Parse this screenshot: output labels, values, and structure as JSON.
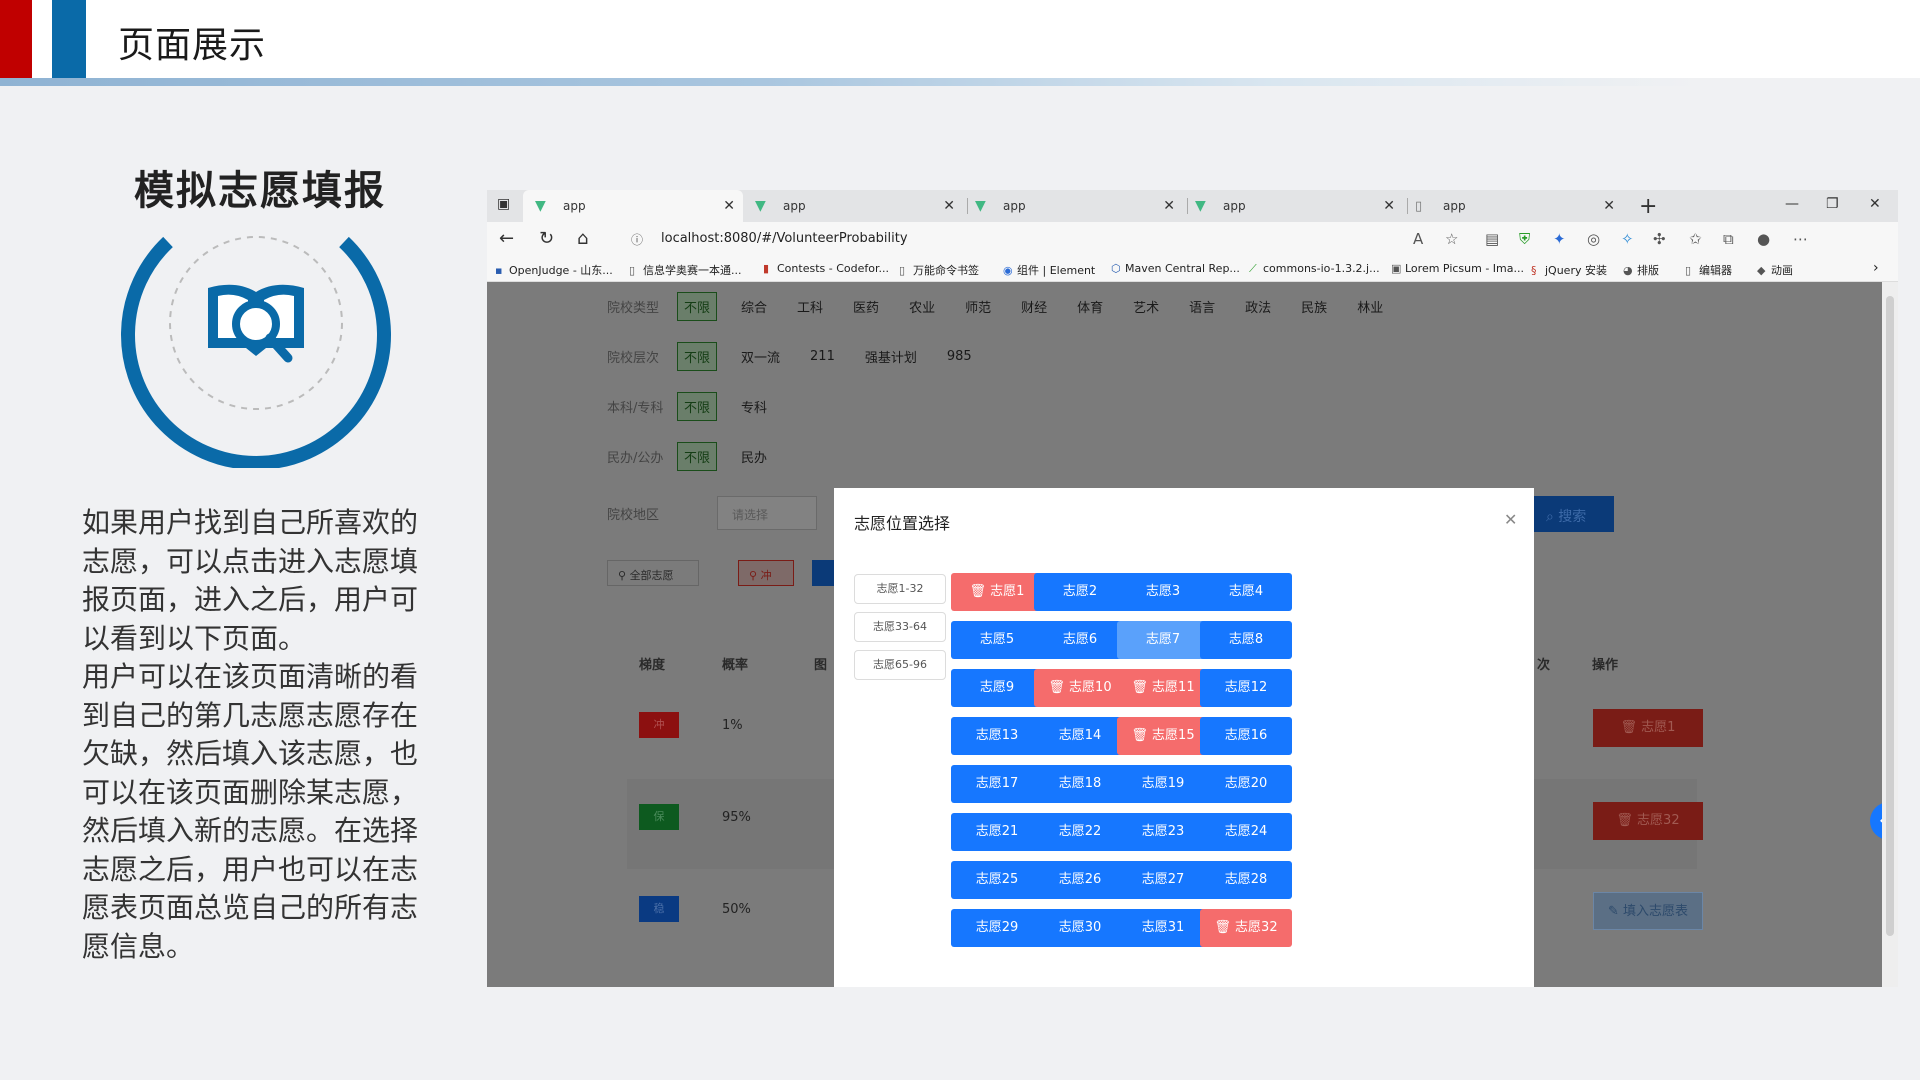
{
  "slide": {
    "title": "页面展示",
    "section_title": "模拟志愿填报",
    "description": [
      "如果用户找到自己所喜欢的志愿，可以点击进入志愿填报页面，进入之后，用户可以看到以下页面。",
      "用户可以在该页面清晰的看到自己的第几志愿志愿存在欠缺，然后填入该志愿，也可以在该页面删除某志愿，然后填入新的志愿。在选择志愿之后，用户也可以在志愿表页面总览自己的所有志愿信息。"
    ],
    "colors": {
      "red": "#c00000",
      "blue": "#0a6aa8"
    }
  },
  "browser": {
    "tabs": [
      {
        "label": "app",
        "icon": "vue-logo-icon"
      },
      {
        "label": "app",
        "icon": "vue-logo-icon"
      },
      {
        "label": "app",
        "icon": "vue-logo-icon"
      },
      {
        "label": "app",
        "icon": "vue-logo-icon"
      },
      {
        "label": "app",
        "icon": "document-icon"
      }
    ],
    "url": "localhost:8080/#/VolunteerProbability",
    "bookmarks": [
      "OpenJudge - 山东...",
      "信息学奥赛一本通...",
      "Contests - Codefor...",
      "万能命令书签",
      "组件 | Element",
      "Maven Central Rep...",
      "commons-io-1.3.2.j...",
      "Lorem Picsum - Ima...",
      "jQuery 安装",
      "排版",
      "编辑器",
      "动画"
    ]
  },
  "page": {
    "filters": [
      {
        "label": "院校类型",
        "any": "不限",
        "options": [
          "综合",
          "工科",
          "医药",
          "农业",
          "师范",
          "财经",
          "体育",
          "艺术",
          "语言",
          "政法",
          "民族",
          "林业"
        ]
      },
      {
        "label": "院校层次",
        "any": "不限",
        "options": [
          "双一流",
          "211",
          "强基计划",
          "985"
        ]
      },
      {
        "label": "本科/专科",
        "any": "不限",
        "options": [
          "专科"
        ]
      },
      {
        "label": "民办/公办",
        "any": "不限",
        "options": [
          "民办"
        ]
      }
    ],
    "region_label": "院校地区",
    "region_placeholder": "请选择",
    "search_label": "搜索",
    "all_button": "全部志愿",
    "chong_button": "冲",
    "columns": {
      "level": "梯度",
      "prob": "概率",
      "icon": "图",
      "rank": "次",
      "op": "操作"
    },
    "rows": [
      {
        "level": "冲",
        "prob": "1%",
        "op": "志愿1",
        "level_color": "#8c1010"
      },
      {
        "level": "保",
        "prob": "95%",
        "op": "志愿32",
        "level_color": "#0d5a1f"
      },
      {
        "level": "稳",
        "prob": "50%",
        "op": "填入志愿表",
        "level_color": "#0a3a82"
      }
    ]
  },
  "modal": {
    "title": "志愿位置选择",
    "ranges": [
      "志愿1-32",
      "志愿33-64",
      "志愿65-96"
    ],
    "slots": [
      {
        "label": "志愿1",
        "state": "filled"
      },
      {
        "label": "志愿2",
        "state": "empty"
      },
      {
        "label": "志愿3",
        "state": "empty"
      },
      {
        "label": "志愿4",
        "state": "empty"
      },
      {
        "label": "志愿5",
        "state": "empty"
      },
      {
        "label": "志愿6",
        "state": "empty"
      },
      {
        "label": "志愿7",
        "state": "hover"
      },
      {
        "label": "志愿8",
        "state": "empty"
      },
      {
        "label": "志愿9",
        "state": "empty"
      },
      {
        "label": "志愿10",
        "state": "filled"
      },
      {
        "label": "志愿11",
        "state": "filled"
      },
      {
        "label": "志愿12",
        "state": "empty"
      },
      {
        "label": "志愿13",
        "state": "empty"
      },
      {
        "label": "志愿14",
        "state": "empty"
      },
      {
        "label": "志愿15",
        "state": "filled"
      },
      {
        "label": "志愿16",
        "state": "empty"
      },
      {
        "label": "志愿17",
        "state": "empty"
      },
      {
        "label": "志愿18",
        "state": "empty"
      },
      {
        "label": "志愿19",
        "state": "empty"
      },
      {
        "label": "志愿20",
        "state": "empty"
      },
      {
        "label": "志愿21",
        "state": "empty"
      },
      {
        "label": "志愿22",
        "state": "empty"
      },
      {
        "label": "志愿23",
        "state": "empty"
      },
      {
        "label": "志愿24",
        "state": "empty"
      },
      {
        "label": "志愿25",
        "state": "empty"
      },
      {
        "label": "志愿26",
        "state": "empty"
      },
      {
        "label": "志愿27",
        "state": "empty"
      },
      {
        "label": "志愿28",
        "state": "empty"
      },
      {
        "label": "志愿29",
        "state": "empty"
      },
      {
        "label": "志愿30",
        "state": "empty"
      },
      {
        "label": "志愿31",
        "state": "empty"
      },
      {
        "label": "志愿32",
        "state": "filled"
      }
    ],
    "colors": {
      "empty": "#1677ff",
      "filled": "#f56c6c",
      "hover": "#5aa1fb"
    }
  }
}
